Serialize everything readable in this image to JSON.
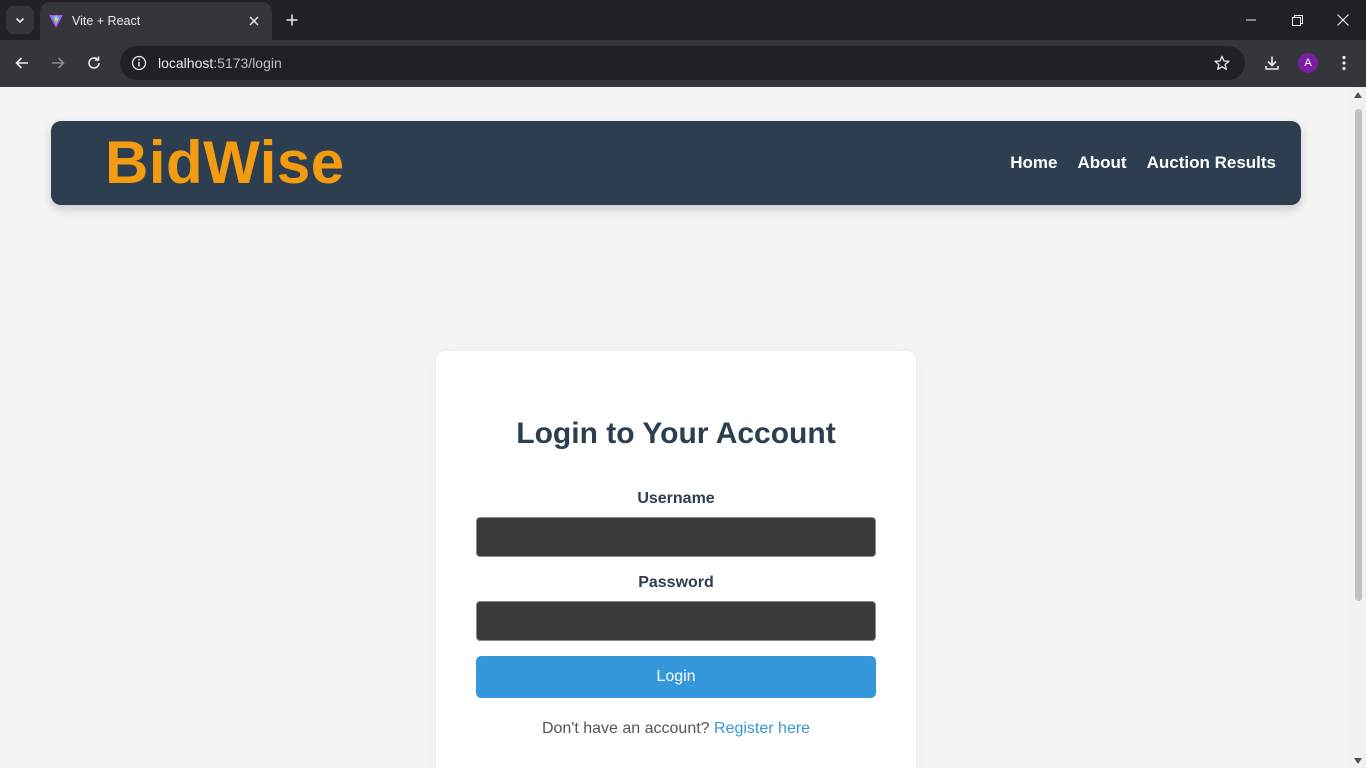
{
  "browser": {
    "tab_title": "Vite + React",
    "url_host": "localhost",
    "url_path": ":5173/login",
    "profile_initial": "A",
    "icons": {
      "tab_list": "chevron-down-icon",
      "favicon": "vite-logo-icon",
      "tab_close": "close-icon",
      "new_tab": "plus-icon",
      "minimize": "minimize-icon",
      "restore": "restore-icon",
      "close_window": "close-icon",
      "back": "arrow-left-icon",
      "forward": "arrow-right-icon",
      "reload": "reload-icon",
      "site_info": "info-icon",
      "bookmark": "star-icon",
      "downloads": "download-icon",
      "menu": "kebab-menu-icon"
    }
  },
  "header": {
    "brand": "BidWise",
    "nav": {
      "home": "Home",
      "about": "About",
      "auction_results": "Auction Results"
    }
  },
  "login": {
    "title": "Login to Your Account",
    "username_label": "Username",
    "username_value": "",
    "password_label": "Password",
    "password_value": "",
    "submit_label": "Login",
    "register_prompt": "Don't have an account?",
    "register_link": "Register here"
  },
  "colors": {
    "header_bg": "#2c3e50",
    "brand": "#f39c12",
    "button": "#3498db",
    "page_bg": "#f4f4f4"
  }
}
